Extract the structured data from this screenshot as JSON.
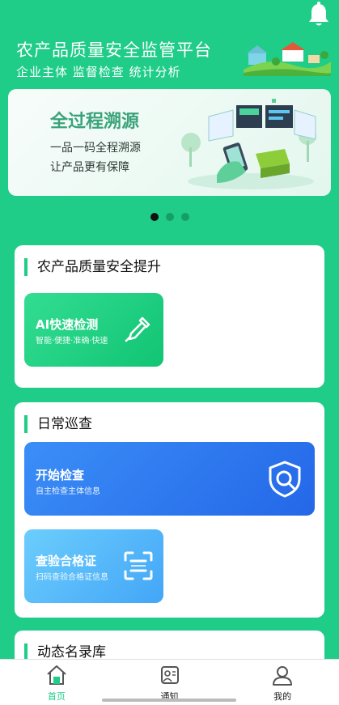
{
  "header": {
    "title": "农产品质量安全监管平台",
    "subtitle": "企业主体 监督检查 统计分析"
  },
  "banner": {
    "title": "全过程溯源",
    "line1": "一品一码全程溯源",
    "line2": "让产品更有保障"
  },
  "carousel": {
    "count": 3,
    "active": 0
  },
  "section_quality": {
    "title": "农产品质量安全提升",
    "ai_button": {
      "title": "AI快速检测",
      "subtitle": "智能·便捷·准确·快速"
    }
  },
  "section_patrol": {
    "title": "日常巡查",
    "start_check": {
      "title": "开始检查",
      "subtitle": "自主检查主体信息"
    },
    "cert_check": {
      "title": "查验合格证",
      "subtitle": "扫码查验合格证信息"
    }
  },
  "section_registry": {
    "title": "动态名录库"
  },
  "tabbar": {
    "items": [
      {
        "label": "首页",
        "icon": "home-icon",
        "active": true
      },
      {
        "label": "通知",
        "icon": "notification-icon",
        "active": false
      },
      {
        "label": "我的",
        "icon": "profile-icon",
        "active": false
      }
    ]
  },
  "colors": {
    "brand": "#1fcc88",
    "blue": "#2f7ff4",
    "light_blue": "#52b8fb"
  }
}
